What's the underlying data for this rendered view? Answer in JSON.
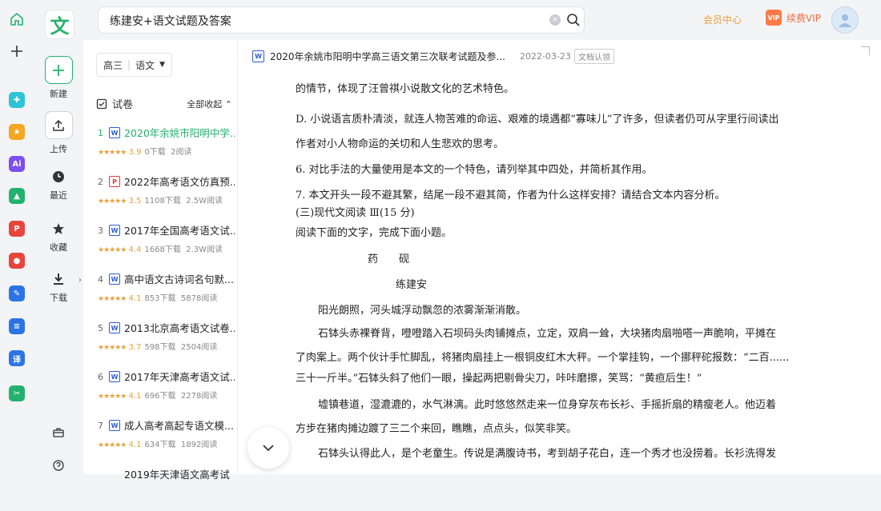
{
  "app": {
    "logo_char": "文",
    "brand_color": "#23b26d"
  },
  "rail": {
    "apps": [
      {
        "name": "home-icon"
      },
      {
        "name": "add-icon"
      },
      {
        "name": "puzzle-app-icon",
        "color": "#2ec4d6",
        "glyph": "✚"
      },
      {
        "name": "star-app-icon",
        "color": "#f5a623",
        "glyph": "★"
      },
      {
        "name": "ai-app-icon",
        "color": "#7b4ff2",
        "glyph": "Ai"
      },
      {
        "name": "image-ai-app-icon",
        "color": "#23b26d",
        "glyph": "▲"
      },
      {
        "name": "pdf-ai-app-icon",
        "color": "#e8453c",
        "glyph": "P"
      },
      {
        "name": "record-ai-app-icon",
        "color": "#e8453c",
        "glyph": "●"
      },
      {
        "name": "edit-ai-app-icon",
        "color": "#2b74e6",
        "glyph": "✎"
      },
      {
        "name": "doc-ai-app-icon",
        "color": "#2b74e6",
        "glyph": "≡"
      },
      {
        "name": "translate-app-icon",
        "color": "#2b74e6",
        "glyph": "译"
      },
      {
        "name": "scissors-app-icon",
        "color": "#23b26d",
        "glyph": "✂"
      }
    ]
  },
  "side": {
    "new_label": "新建",
    "upload_label": "上传",
    "recent_label": "最近",
    "favorites_label": "收藏",
    "download_label": "下载"
  },
  "search": {
    "value": "练建安+语文试题及答案"
  },
  "top": {
    "member_label": "会员中心",
    "vip_label": "续费VIP",
    "vip_badge": "VIP"
  },
  "filter": {
    "grade": "高三",
    "subject": "语文"
  },
  "section": {
    "title": "试卷",
    "toggle_label": "全部收起"
  },
  "docs": [
    {
      "num": "1",
      "type": "W",
      "title": "2020年余姚市阳明中学...",
      "rating": "3.9",
      "downloads": "0下载",
      "reads": "2阅读"
    },
    {
      "num": "2",
      "type": "P",
      "title": "2022年高考语文仿真预...",
      "rating": "3.5",
      "downloads": "1108下载",
      "reads": "2.5W阅读"
    },
    {
      "num": "3",
      "type": "W",
      "title": "2017年全国高考语文试...",
      "rating": "4.4",
      "downloads": "1668下载",
      "reads": "2.3W阅读"
    },
    {
      "num": "4",
      "type": "W",
      "title": "高中语文古诗词名句默...",
      "rating": "4.1",
      "downloads": "853下载",
      "reads": "5878阅读"
    },
    {
      "num": "5",
      "type": "W",
      "title": "2013北京高考语文试卷...",
      "rating": "3.7",
      "downloads": "598下载",
      "reads": "2504阅读"
    },
    {
      "num": "6",
      "type": "W",
      "title": "2017年天津高考语文试...",
      "rating": "4.1",
      "downloads": "696下载",
      "reads": "2278阅读"
    },
    {
      "num": "7",
      "type": "W",
      "title": "成人高考高起专语文模...",
      "rating": "4.1",
      "downloads": "634下载",
      "reads": "1892阅读"
    },
    {
      "num": "",
      "type": "",
      "title": "2019年天津语文高考试",
      "rating": "",
      "downloads": "",
      "reads": ""
    }
  ],
  "document": {
    "title": "2020年余姚市阳明中学高三语文第三次联考试题及参...",
    "date": "2022-03-23",
    "tag": "文档认领",
    "lines": [
      "的情节，体现了汪曾祺小说散文化的艺术特色。",
      "D. 小说语言质朴清淡，就连人物苦难的命运、艰难的境遇都“寡味儿”了许多，但读者仍可从字里行间读出",
      "作者对小人物命运的关切和人生悲欢的思考。",
      "6. 对比手法的大量使用是本文的一个特色，请列举其中四处，并简析其作用。",
      "7. 本文开头一段不避其繁，结尾一段不避其简，作者为什么这样安排？请结合文本内容分析。",
      "(三)现代文阅读 Ⅲ(15 分)",
      "阅读下面的文字，完成下面小题。",
      "药　　砚",
      "练建安",
      "阳光朗照，河头城浮动飘忽的浓雾渐渐消散。",
      "石钵头赤裸脊背，噔噔踏入石坝码头肉铺摊点，立定，双肩一耸，大块猪肉扇啪嗒一声脆响，平摊在",
      "了肉案上。两个伙计手忙脚乱，将猪肉扇挂上一根铜皮红木大秤。一个掌挂钩，一个挪秤砣报数：“二百......",
      "三十一斤半。”石钵头斜了他们一眼，操起两把剔骨尖刀，咔咔磨擦，笑骂：“黄疸后生！”",
      "墟镇巷道，湿漉漉的，水气淋漓。此时悠悠然走来一位身穿灰布长衫、手摇折扇的精瘦老人。他迈着",
      "方步在猪肉摊边踱了三二个来回，瞧瞧，点点头，似笑非笑。",
      "石钵头认得此人，是个老童生。传说是满腹诗书，考到胡子花白，连一个秀才也没捞着。长衫洗得发"
    ]
  }
}
